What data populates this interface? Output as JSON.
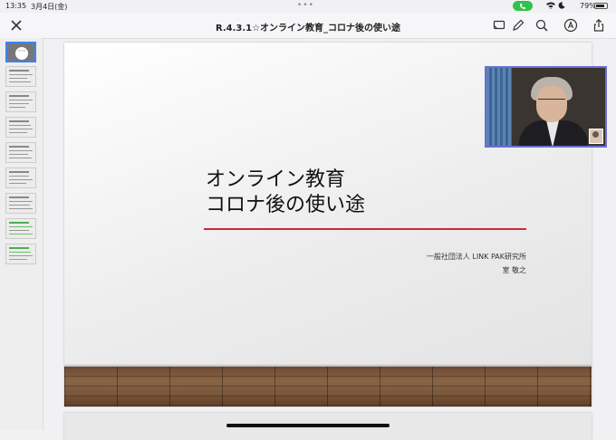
{
  "status_bar": {
    "time": "13:35",
    "date": "3月4日(金)",
    "battery_percent": "79%",
    "battery_level": 0.79
  },
  "toolbar": {
    "title": "R.4.3.1☆オンライン教育_コロナ後の使い途",
    "icons": [
      "close-icon",
      "screen-share-icon",
      "pencil-icon",
      "search-icon",
      "markup-icon",
      "share-icon"
    ]
  },
  "sidebar": {
    "more_label": "···",
    "thumbnails": [
      {
        "selected": true,
        "style": "title"
      },
      {
        "selected": false,
        "style": "text"
      },
      {
        "selected": false,
        "style": "text"
      },
      {
        "selected": false,
        "style": "text"
      },
      {
        "selected": false,
        "style": "text"
      },
      {
        "selected": false,
        "style": "text"
      },
      {
        "selected": false,
        "style": "text"
      },
      {
        "selected": false,
        "style": "green"
      },
      {
        "selected": false,
        "style": "green"
      }
    ]
  },
  "slide": {
    "title_line1": "オンライン教育",
    "title_line2": "コロナ後の使い途",
    "organization": "一般社団法人 LINK PAK研究所",
    "author": "室 敬之"
  },
  "colors": {
    "accent_red": "#c72b3a",
    "selection_blue": "#3b82f6",
    "video_border": "#6b6fd1",
    "call_green": "#31c24d"
  }
}
